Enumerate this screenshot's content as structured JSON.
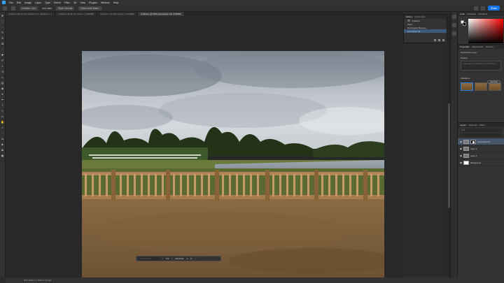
{
  "menu": [
    "File",
    "Edit",
    "Image",
    "Layer",
    "Type",
    "Select",
    "Filter",
    "3D",
    "View",
    "Plugins",
    "Window",
    "Help"
  ],
  "options": {
    "feather": "Feather: 0 px",
    "anti_alias": "Anti-alias",
    "style": "Style: Normal",
    "select_mask": "Select and Mask...",
    "share": "Share"
  },
  "tabs": [
    "Untitled-1 @ 50.5% (Gradient fill - Backdrop...)",
    "Untitled-1 @ 66.7% (Layer 1, RGB/8#)",
    "Untitled-1 @ 40% (Layer 1, RGB/8#)",
    "Untitled-1 @ 50% (Generative Fill, RGB/8#)"
  ],
  "history": {
    "tabs": [
      "History",
      "Comments"
    ],
    "items": [
      "Untitled-1",
      "Open",
      "Rectangular Marquee",
      "Generative Fill"
    ]
  },
  "context_bar": {
    "placeholder": "Add a prompt...",
    "counter": "1/3",
    "comments": "Generate"
  },
  "properties": {
    "tabs": [
      "Properties",
      "Adjustments",
      "Libraries"
    ],
    "layer_type": "Generative Layer",
    "prompt_label": "Prompt",
    "prompt_placeholder": "Leave blank to fill based on surroundings",
    "generate": "Generate",
    "variations_label": "Variations"
  },
  "layers": {
    "tabs": [
      "Layers",
      "Channels",
      "Paths"
    ],
    "filter": "Kind",
    "items": [
      {
        "name": "Generative Fill",
        "selected": true
      },
      {
        "name": "Layer 1",
        "selected": false
      },
      {
        "name": "Layer 0",
        "selected": false
      },
      {
        "name": "Background",
        "selected": false
      }
    ]
  },
  "status": "50%     2048 px x 1536 px (72 ppi)"
}
